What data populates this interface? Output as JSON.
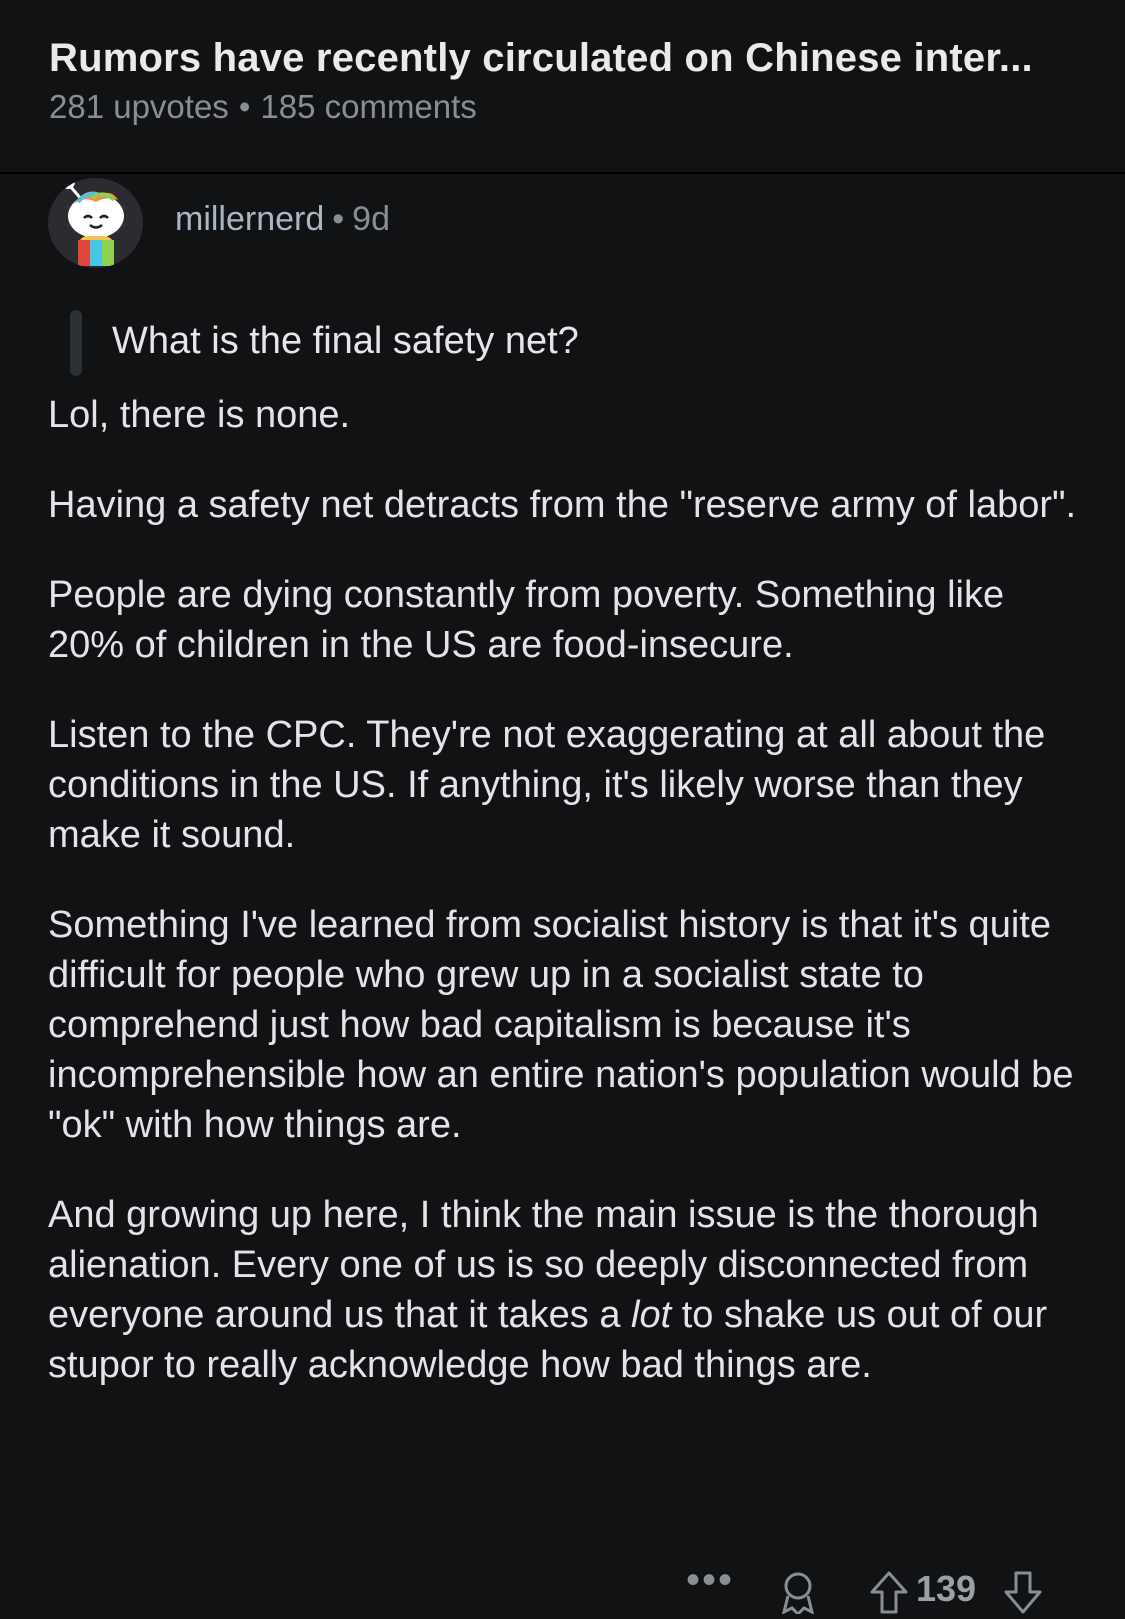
{
  "post": {
    "title": "Rumors have recently circulated on Chinese inter...",
    "upvotes": "281 upvotes",
    "separator": "•",
    "comments": "185 comments"
  },
  "comment": {
    "author": "millernerd",
    "separator": "•",
    "age": "9d",
    "avatar_icon": "snoo-avatar-icon",
    "quote": "What is the final safety net?",
    "paragraphs": [
      "Lol, there is none.",
      "Having a safety net detracts from the \"reserve army of labor\".",
      "People are dying constantly from poverty. Something like 20% of children in the US are food-insecure.",
      "Listen to the CPC. They're not exaggerating at all about the conditions in the US. If anything, it's likely worse than they make it sound.",
      "Something I've learned from socialist history is that it's quite difficult for people who grew up in a socialist state to comprehend just how bad capitalism is because it's incomprehensible how an entire nation's population would be \"ok\" with how things are."
    ],
    "last_paragraph": {
      "before": "And growing up here, I think the main issue is the thorough alienation. Every one of us is so deeply disconnected from everyone around us that it takes a ",
      "emphasis": "lot",
      "after": " to shake us out of our stupor to really acknowledge how bad things are."
    },
    "actions": {
      "more": "•••",
      "award_icon": "award-icon",
      "upvote_icon": "upvote-arrow-icon",
      "score": "139",
      "downvote_icon": "downvote-arrow-icon"
    }
  },
  "colors": {
    "background": "#111214",
    "text": "#e4e6e9",
    "muted": "#8a8e94",
    "username": "#a9b6c3"
  }
}
